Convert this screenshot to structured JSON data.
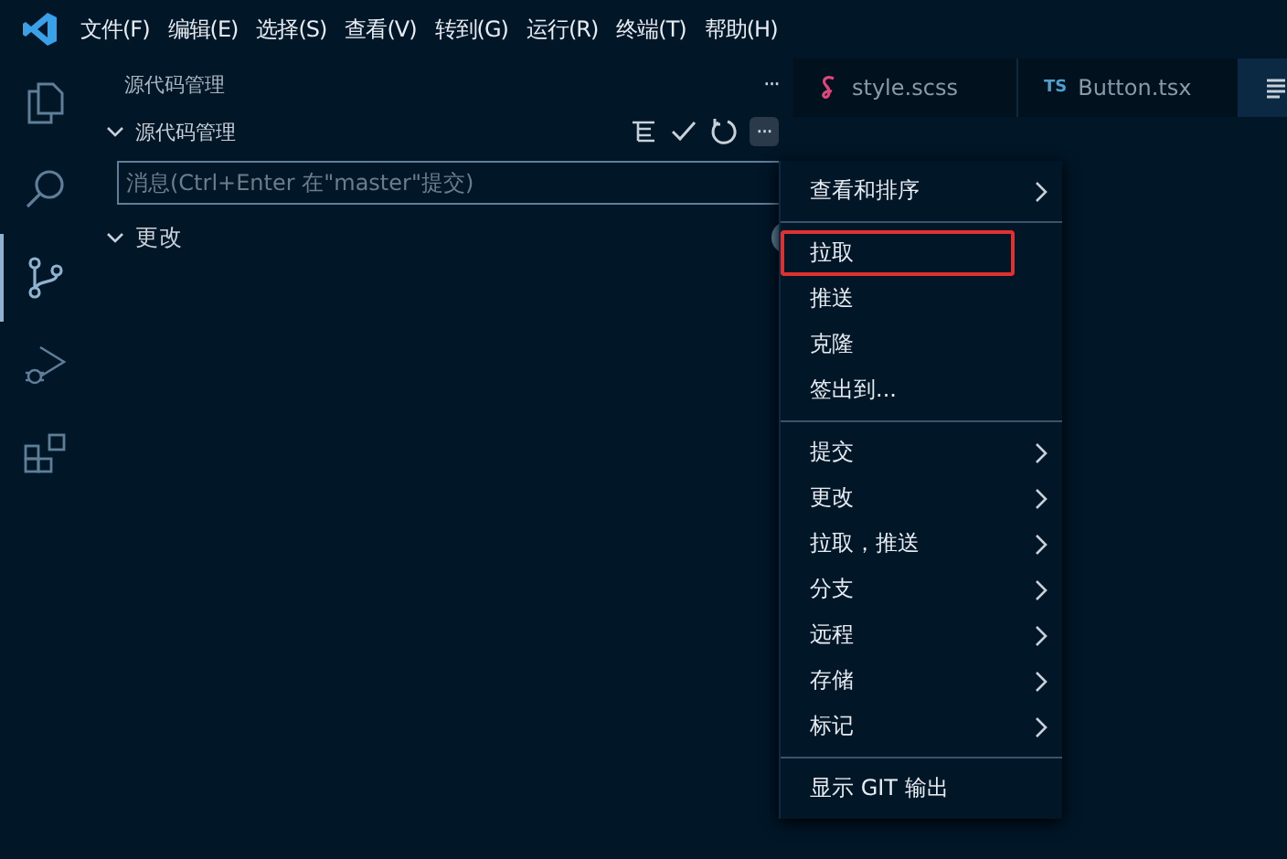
{
  "menubar": [
    "文件(F)",
    "编辑(E)",
    "选择(S)",
    "查看(V)",
    "转到(G)",
    "运行(R)",
    "终端(T)",
    "帮助(H)"
  ],
  "activity_bar": [
    {
      "kind": "files",
      "selected": false
    },
    {
      "kind": "search",
      "selected": false
    },
    {
      "kind": "scm",
      "selected": true
    },
    {
      "kind": "debug",
      "selected": false
    },
    {
      "kind": "extensions",
      "selected": false
    }
  ],
  "sidebar": {
    "title": "源代码管理",
    "more": "···",
    "section": {
      "title": "源代码管理",
      "expanded": true,
      "more": "···"
    },
    "message": {
      "placeholder": "消息(Ctrl+Enter 在\"master\"提交)"
    },
    "changes": {
      "title": "更改",
      "expanded": true
    }
  },
  "tabs": [
    {
      "label": "style.scss",
      "kind": "scss",
      "selected": false
    },
    {
      "label": "TS",
      "kind": "ts",
      "name": "Button.tsx",
      "selected": false
    },
    {
      "kind": "preview",
      "selected": true
    }
  ],
  "menu": {
    "groups": [
      [
        {
          "label": "查看和排序",
          "submenu": true,
          "highlighted": false
        }
      ],
      [
        {
          "label": "拉取",
          "submenu": false,
          "highlighted": true
        },
        {
          "label": "推送",
          "submenu": false,
          "highlighted": false
        },
        {
          "label": "克隆",
          "submenu": false,
          "highlighted": false
        },
        {
          "label": "签出到...",
          "submenu": false,
          "highlighted": false
        }
      ],
      [
        {
          "label": "提交",
          "submenu": true,
          "highlighted": false
        },
        {
          "label": "更改",
          "submenu": true,
          "highlighted": false
        },
        {
          "label": "拉取，推送",
          "submenu": true,
          "highlighted": false
        },
        {
          "label": "分支",
          "submenu": true,
          "highlighted": false
        },
        {
          "label": "远程",
          "submenu": true,
          "highlighted": false
        },
        {
          "label": "存储",
          "submenu": true,
          "highlighted": false
        },
        {
          "label": "标记",
          "submenu": true,
          "highlighted": false
        }
      ],
      [
        {
          "label": "显示 GIT 输出",
          "submenu": false,
          "highlighted": false
        }
      ]
    ]
  }
}
